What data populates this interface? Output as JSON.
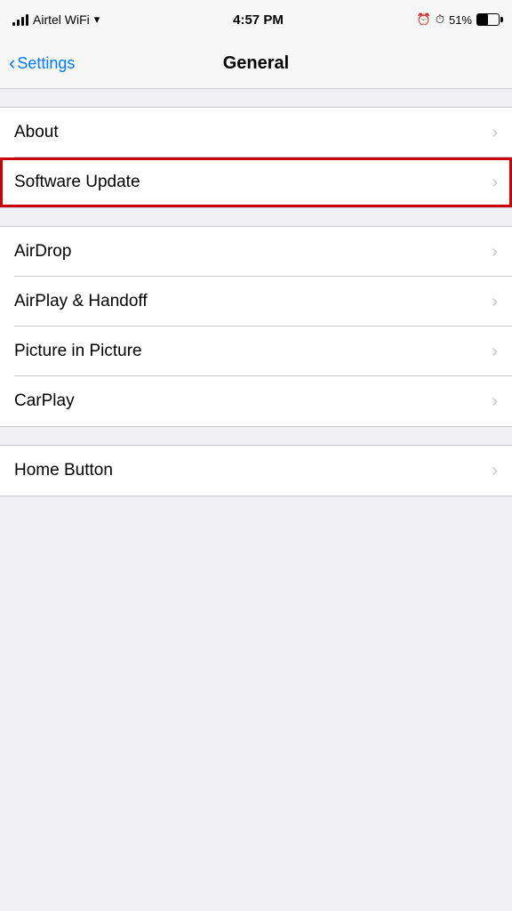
{
  "statusBar": {
    "carrier": "Airtel WiFi",
    "time": "4:57 PM",
    "batteryPercent": "51%"
  },
  "navBar": {
    "backLabel": "Settings",
    "title": "General"
  },
  "groups": [
    {
      "id": "group1",
      "rows": [
        {
          "id": "about",
          "label": "About",
          "highlighted": false
        },
        {
          "id": "software-update",
          "label": "Software Update",
          "highlighted": true
        }
      ]
    },
    {
      "id": "group2",
      "rows": [
        {
          "id": "airdrop",
          "label": "AirDrop",
          "highlighted": false
        },
        {
          "id": "airplay-handoff",
          "label": "AirPlay & Handoff",
          "highlighted": false
        },
        {
          "id": "picture-in-picture",
          "label": "Picture in Picture",
          "highlighted": false
        },
        {
          "id": "carplay",
          "label": "CarPlay",
          "highlighted": false
        }
      ]
    },
    {
      "id": "group3",
      "rows": [
        {
          "id": "home-button",
          "label": "Home Button",
          "highlighted": false
        }
      ]
    }
  ]
}
